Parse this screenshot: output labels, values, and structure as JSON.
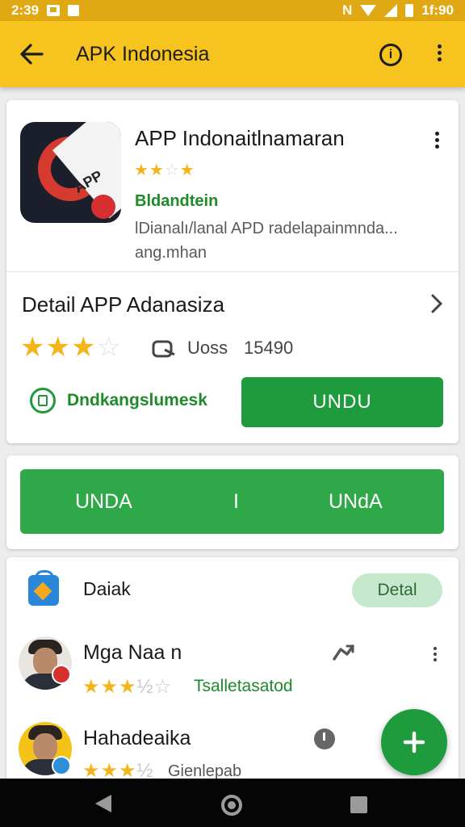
{
  "status_bar": {
    "time": "2:39",
    "clock_right": "1f:90",
    "icons": [
      "notification-icon",
      "app-notification-icon",
      "no-sim-icon",
      "wifi-icon",
      "signal-icon",
      "battery-icon"
    ]
  },
  "app_bar": {
    "title": "APK Indonesia",
    "info_glyph": "i",
    "background": "#f7c31e"
  },
  "app": {
    "name": "APP Indonaitlnamaran",
    "rating_stars": 3,
    "developer": "Bldandtein",
    "description": "lDianalı/lanal APD radelapainmnda... ang.mhan"
  },
  "detail": {
    "title": "Detail APP Adanasiza",
    "rating_stars": 3.5,
    "downloads_label": "Uoss",
    "downloads_count": "15490",
    "doc_link": "Dndkangslumesk",
    "primary_button": "UNDU"
  },
  "split_button": {
    "left": "UNDA",
    "divider": "I",
    "right": "UNdA"
  },
  "list": {
    "header": "Daiak",
    "detail_button": "Detal",
    "items": [
      {
        "name": "Mga Naa n",
        "rating_stars": 3.5,
        "meta": "Tsalletasatod"
      },
      {
        "name": "Hahadeaika",
        "rating_stars": 3.5,
        "meta": "Gienlepab"
      }
    ]
  },
  "fab_glyph": "+",
  "colors": {
    "accent_green": "#1e9b3c",
    "toolbar_yellow": "#f7c31e",
    "star_yellow": "#f2b51b"
  }
}
